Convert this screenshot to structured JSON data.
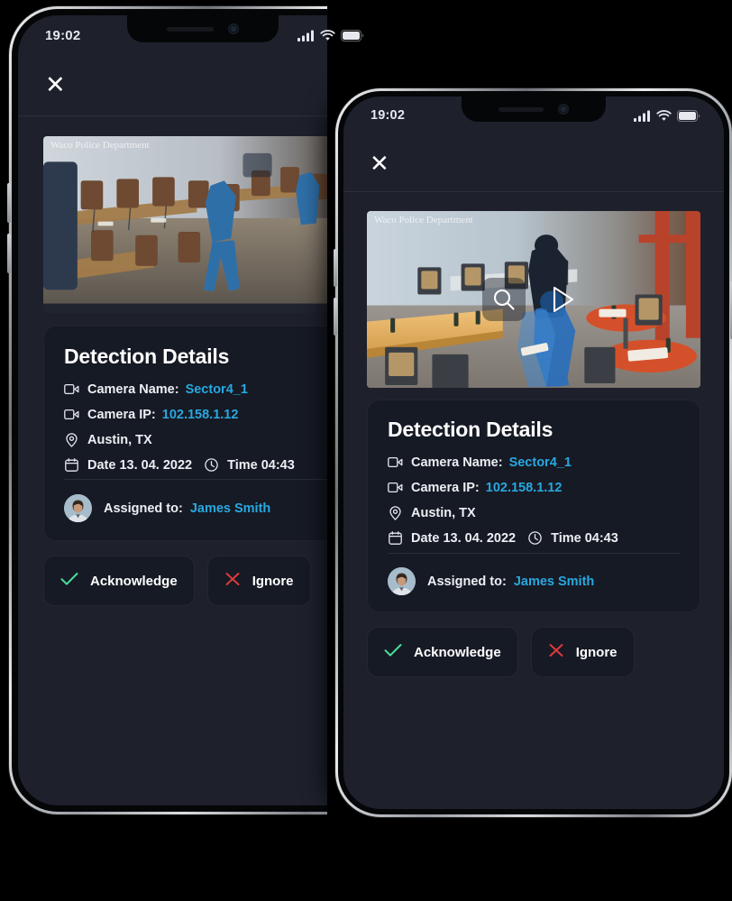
{
  "meta": {
    "background": "#000000",
    "screen_bg": "#1E212C",
    "card_bg": "#161A24",
    "accent": "#29A8E0",
    "ok_color": "#4ADE9B",
    "danger_color": "#E03A3A"
  },
  "status_bar": {
    "time": "19:02",
    "signal_icon": "cellular-bars-icon",
    "wifi_icon": "wifi-icon",
    "battery_icon": "battery-full-icon"
  },
  "app_bar": {
    "close_label": "✕",
    "close_icon": "close-icon"
  },
  "video": {
    "watermark": "Waco Police Department",
    "zoom_icon": "magnifier-icon",
    "play_icon": "play-icon",
    "alt": "surveillance-footage-restaurant-interior"
  },
  "details": {
    "title": "Detection Details",
    "rows": [
      {
        "icon": "video-camera-icon",
        "label": "Camera Name:",
        "value": "Sector4_1",
        "value_accent": true
      },
      {
        "icon": "video-camera-icon",
        "label": "Camera IP:",
        "value": "102.158.1.12",
        "value_accent": true
      },
      {
        "icon": "location-pin-icon",
        "label": "Austin, TX",
        "value": "",
        "value_accent": false
      }
    ],
    "datetime": {
      "date_icon": "calendar-icon",
      "date_label": "Date 13. 04. 2022",
      "time_icon": "clock-icon",
      "time_label": "Time 04:43"
    },
    "assigned": {
      "avatar_icon": "user-avatar",
      "label": "Assigned to:",
      "value": "James Smith"
    }
  },
  "actions": [
    {
      "id": "acknowledge",
      "icon": "check-icon",
      "label": "Acknowledge",
      "color": "#4ADE9B"
    },
    {
      "id": "ignore",
      "icon": "x-icon",
      "label": "Ignore",
      "color": "#E03A3A"
    }
  ]
}
